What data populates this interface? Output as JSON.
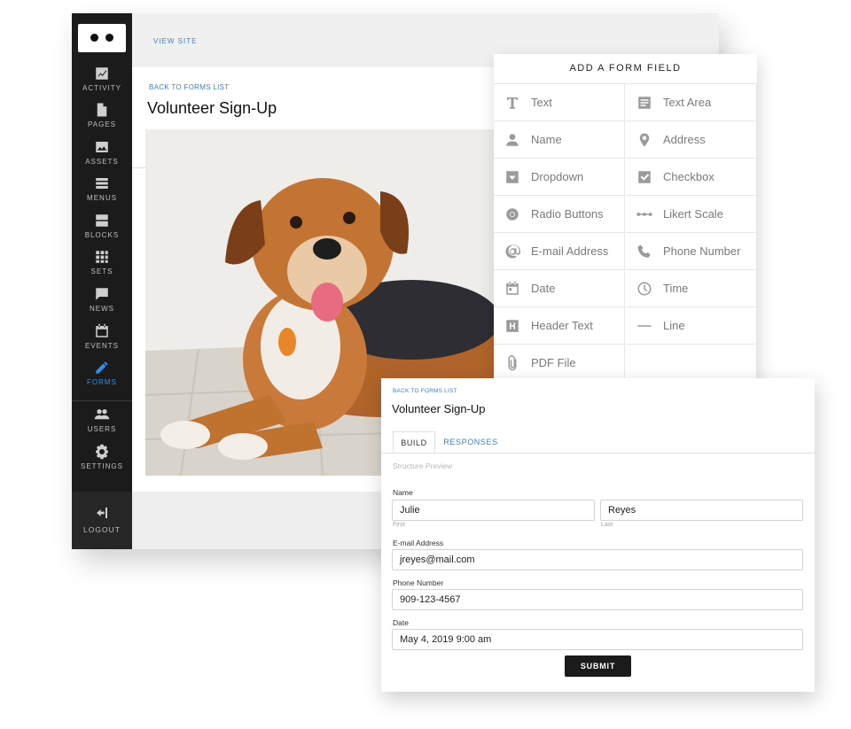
{
  "sidebar": {
    "items": [
      {
        "label": "ACTIVITY",
        "icon": "activity-chart-icon"
      },
      {
        "label": "PAGES",
        "icon": "page-icon"
      },
      {
        "label": "ASSETS",
        "icon": "image-icon"
      },
      {
        "label": "MENUS",
        "icon": "menu-list-icon"
      },
      {
        "label": "BLOCKS",
        "icon": "blocks-icon"
      },
      {
        "label": "SETS",
        "icon": "grid-icon"
      },
      {
        "label": "NEWS",
        "icon": "chat-icon"
      },
      {
        "label": "EVENTS",
        "icon": "calendar-icon"
      },
      {
        "label": "FORMS",
        "icon": "pencil-icon",
        "active": true
      },
      {
        "label": "USERS",
        "icon": "users-icon"
      },
      {
        "label": "SETTINGS",
        "icon": "gear-icon"
      }
    ],
    "logout_label": "LOGOUT"
  },
  "header": {
    "view_site": "VIEW SITE"
  },
  "main": {
    "back_link": "BACK TO FORMS LIST",
    "title": "Volunteer Sign-Up"
  },
  "field_panel": {
    "title": "ADD A FORM FIELD",
    "fields": [
      {
        "label": "Text",
        "icon": "text-icon"
      },
      {
        "label": "Text Area",
        "icon": "text-area-icon"
      },
      {
        "label": "Name",
        "icon": "person-icon"
      },
      {
        "label": "Address",
        "icon": "location-pin-icon"
      },
      {
        "label": "Dropdown",
        "icon": "dropdown-icon"
      },
      {
        "label": "Checkbox",
        "icon": "checkbox-icon"
      },
      {
        "label": "Radio Buttons",
        "icon": "radio-icon"
      },
      {
        "label": "Likert Scale",
        "icon": "likert-scale-icon"
      },
      {
        "label": "E-mail Address",
        "icon": "at-sign-icon"
      },
      {
        "label": "Phone Number",
        "icon": "phone-icon"
      },
      {
        "label": "Date",
        "icon": "calendar-icon"
      },
      {
        "label": "Time",
        "icon": "clock-icon"
      },
      {
        "label": "Header Text",
        "icon": "header-icon"
      },
      {
        "label": "Line",
        "icon": "line-icon"
      },
      {
        "label": "PDF File",
        "icon": "paperclip-icon"
      }
    ]
  },
  "builder": {
    "back_link": "BACK TO FORMS LIST",
    "title": "Volunteer Sign-Up",
    "tabs": [
      "BUILD",
      "RESPONSES"
    ],
    "active_tab": "BUILD",
    "structure_preview": "Structure Preview",
    "name_label": "Name",
    "first_value": "Julie",
    "first_sub": "First",
    "last_value": "Reyes",
    "last_sub": "Last",
    "email_label": "E-mail Address",
    "email_value": "jreyes@mail.com",
    "phone_label": "Phone Number",
    "phone_value": "909-123-4567",
    "date_label": "Date",
    "date_value": "May 4, 2019 9:00 am",
    "submit_label": "SUBMIT"
  },
  "colors": {
    "accent": "#2f8fe6",
    "link": "#3b7fd6",
    "sidebar_bg": "#1b1b1b",
    "submit_bg": "#1b1b1b"
  }
}
